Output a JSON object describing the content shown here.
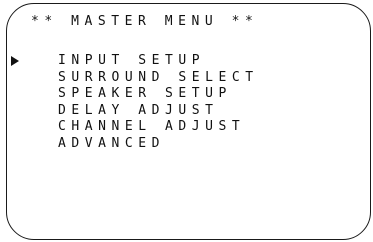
{
  "menu": {
    "title": "** MASTER MENU **",
    "items": [
      {
        "label": "INPUT SETUP",
        "selected": true
      },
      {
        "label": "SURROUND SELECT",
        "selected": false
      },
      {
        "label": "SPEAKER SETUP",
        "selected": false
      },
      {
        "label": "DELAY ADJUST",
        "selected": false
      },
      {
        "label": "CHANNEL ADJUST",
        "selected": false
      },
      {
        "label": "ADVANCED",
        "selected": false
      }
    ],
    "cursor_icon": "right-triangle-pointer"
  }
}
